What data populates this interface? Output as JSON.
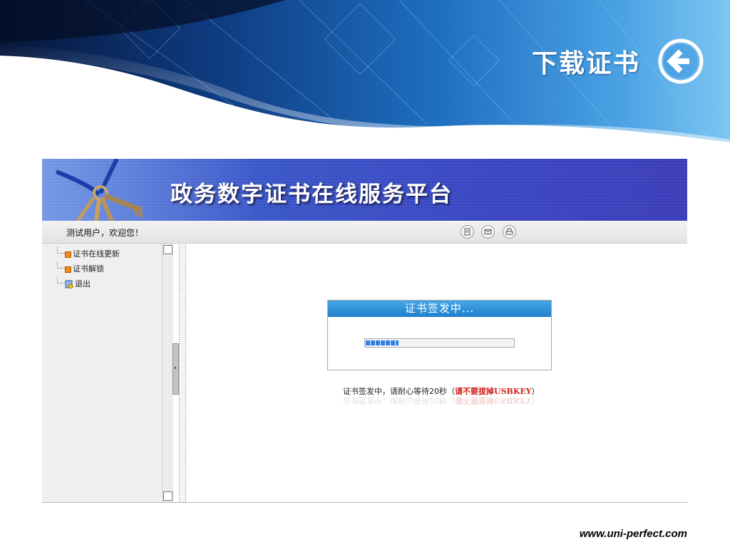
{
  "slide": {
    "title": "下载证书",
    "back_button_icon": "back-arrow-icon",
    "footer_url": "www.uni-perfect.com",
    "colors": {
      "banner_dark": "#0b1f4a",
      "banner_mid": "#1f6fc0",
      "banner_light": "#5fb1ea"
    }
  },
  "app": {
    "title": "政务数字证书在线服务平台",
    "header_color": "#3a4ec4",
    "welcome": "测试用户，欢迎您！",
    "bar_icons": [
      "document-icon",
      "mail-icon",
      "print-icon"
    ],
    "tree": [
      {
        "label": "证书在线更新",
        "icon": "tree-node-icon"
      },
      {
        "label": "证书解锁",
        "icon": "tree-node-icon"
      },
      {
        "label": "退出",
        "icon": "exit-icon"
      }
    ],
    "dialog": {
      "title": "证书签发中...",
      "progress_percent": 22,
      "progress_color": "#2f7fe2"
    },
    "status": {
      "message": "证书签发中，请耐心等待20秒（",
      "warning": "请不要拔掉USBKEY",
      "close": "）",
      "warning_color": "#d31f16"
    }
  }
}
